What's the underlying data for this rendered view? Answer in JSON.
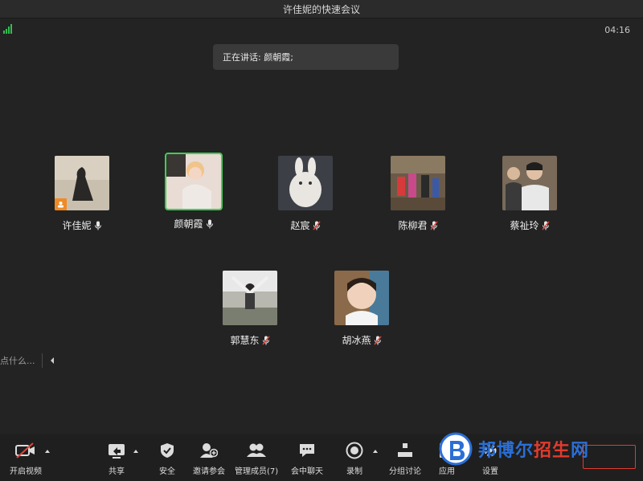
{
  "window": {
    "title": "许佳妮的快速会议"
  },
  "status": {
    "timer": "04:16",
    "speaking_label": "正在讲话: 颜朝霞;"
  },
  "participants": [
    {
      "name": "许佳妮",
      "mic": "on",
      "host": true,
      "active": false
    },
    {
      "name": "颜朝霞",
      "mic": "on",
      "host": false,
      "active": true
    },
    {
      "name": "赵宸",
      "mic": "muted",
      "host": false,
      "active": false
    },
    {
      "name": "陈柳君",
      "mic": "muted",
      "host": false,
      "active": false
    },
    {
      "name": "蔡祉玲",
      "mic": "muted",
      "host": false,
      "active": false
    },
    {
      "name": "郭慧东",
      "mic": "muted",
      "host": false,
      "active": false
    },
    {
      "name": "胡冰燕",
      "mic": "muted",
      "host": false,
      "active": false
    }
  ],
  "chat": {
    "placeholder": "点什么..."
  },
  "toolbar": {
    "video": "开启视频",
    "share": "共享",
    "security": "安全",
    "invite": "邀请参会",
    "manage": "管理成员(7)",
    "chat": "会中聊天",
    "record": "录制",
    "breakout": "分组讨论",
    "apps": "应用",
    "settings": "设置"
  },
  "watermark": {
    "text_a": "邦博尔",
    "text_b": "招生",
    "text_c": "网"
  },
  "colors": {
    "active_border": "#3fce53",
    "signal": "#2fbf4f",
    "host_badge": "#f08a24",
    "muted": "#e0453a"
  }
}
